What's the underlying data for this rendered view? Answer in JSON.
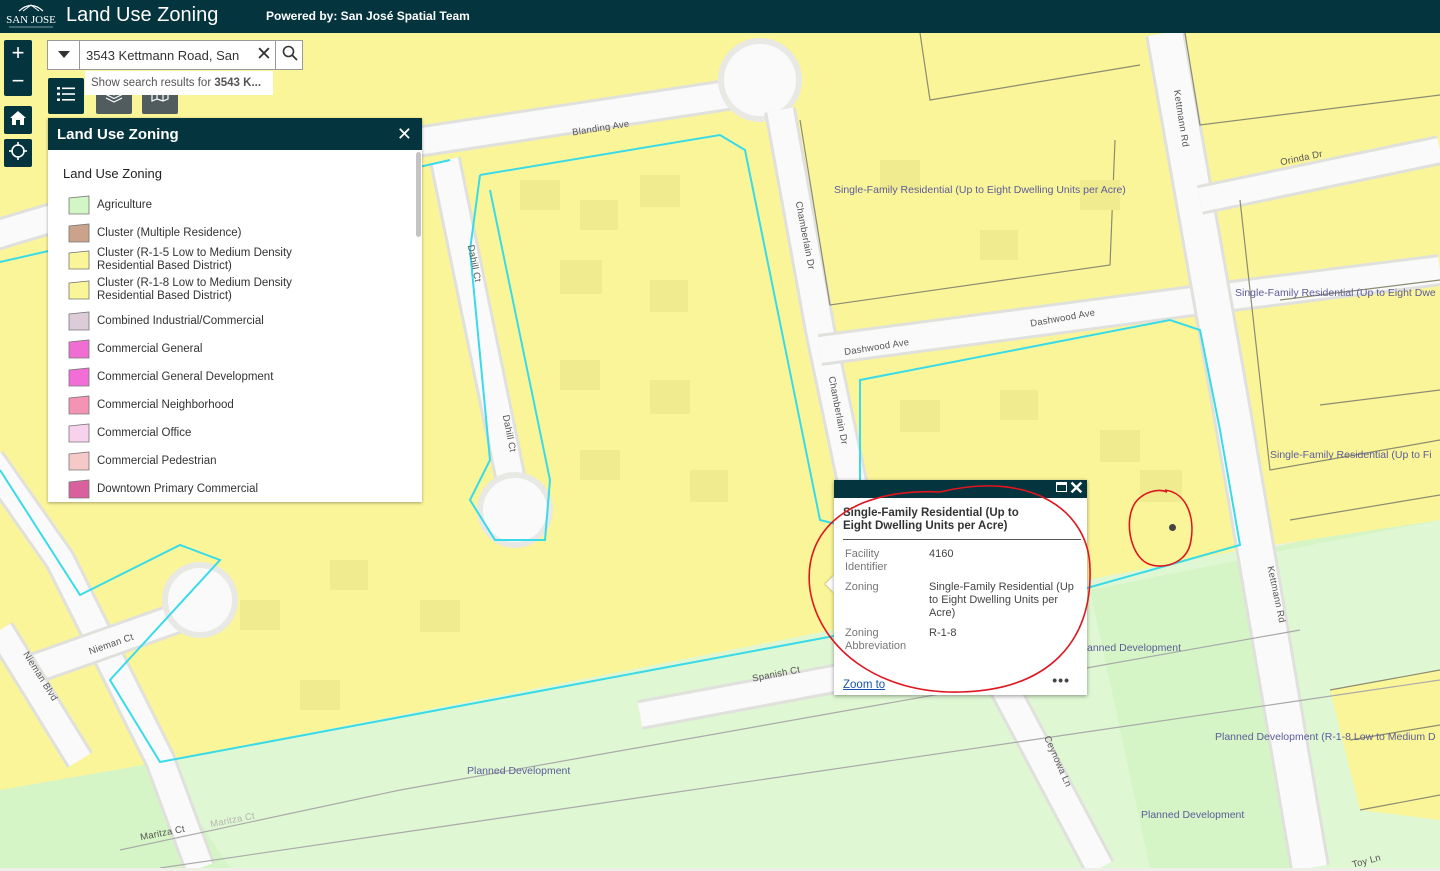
{
  "header": {
    "logo_icon": "city-of-san-jose-logo",
    "title": "Land Use Zoning",
    "powered_by": "Powered by: San José Spatial Team"
  },
  "search": {
    "value": "3543 Kettmann Road, San",
    "suggestion_prefix": "Show search results for ",
    "suggestion_term": "3543 K..."
  },
  "legend": {
    "title": "Land Use Zoning",
    "layer_title": "Land Use Zoning",
    "items": [
      {
        "label": "Agriculture",
        "color": "#d3f6c6"
      },
      {
        "label": "Cluster (Multiple Residence)",
        "color": "#cba38a"
      },
      {
        "label": "Cluster (R-1-5 Low to Medium Density Residential Based District)",
        "color": "#fbf59a"
      },
      {
        "label": "Cluster (R-1-8 Low to Medium Density Residential Based District)",
        "color": "#fbf59a"
      },
      {
        "label": "Combined Industrial/Commercial",
        "color": "#dccbd8"
      },
      {
        "label": "Commercial General",
        "color": "#f06ed2"
      },
      {
        "label": "Commercial General Development",
        "color": "#f26ed6"
      },
      {
        "label": "Commercial Neighborhood",
        "color": "#f593b5"
      },
      {
        "label": "Commercial Office",
        "color": "#f8d2ec"
      },
      {
        "label": "Commercial Pedestrian",
        "color": "#f6c8c8"
      },
      {
        "label": "Downtown Primary Commercial",
        "color": "#d9609c"
      }
    ]
  },
  "map": {
    "zone_labels": [
      "Single-Family Residential (Up to Eight Dwelling Units per Acre)",
      "Single-Family Residential (Up to Eight Dwe",
      "Single-Family Residential (Up to Fi",
      "Planned Development",
      "Planned Development",
      "anned Development",
      "Planned Development (R-1-8 Low to Medium D"
    ],
    "streets": {
      "blanding": "Blanding Ave",
      "kettmann_top": "Kettmann Rd",
      "orinda": "Orinda Dr",
      "chamberlain_top": "Chamberlain Dr",
      "chamberlain_mid": "Chamberlain Dr",
      "dashwood_1": "Dashwood Ave",
      "dashwood_2": "Dashwood Ave",
      "dahill_1": "Dahill Ct",
      "dahill_2": "Dahill Ct",
      "nieman_ct": "Nieman Ct",
      "nieman_blvd": "Nieman Blvd",
      "spanish": "Spanish Ct",
      "ceynowa": "Ceynowa Ln",
      "kettmann_bottom": "Kettmann Rd",
      "maritza_1": "Maritza Ct",
      "maritza_2": "Maritza Ct",
      "toy": "Toy Ln"
    }
  },
  "popup": {
    "title": "Single-Family Residential (Up to Eight Dwelling Units per Acre)",
    "fields": [
      {
        "label": "Facility Identifier",
        "value": "4160"
      },
      {
        "label": "Zoning",
        "value": "Single-Family Residential (Up to Eight Dwelling Units per Acre)"
      },
      {
        "label": "Zoning Abbreviation",
        "value": "R-1-8"
      }
    ],
    "zoom_label": "Zoom to",
    "more_label": "•••"
  },
  "colors": {
    "header": "#04343e",
    "residential": "#fbf59a",
    "planned": "#d3f6c6",
    "highlight": "#39dbe8",
    "annotation": "#e0161f"
  }
}
